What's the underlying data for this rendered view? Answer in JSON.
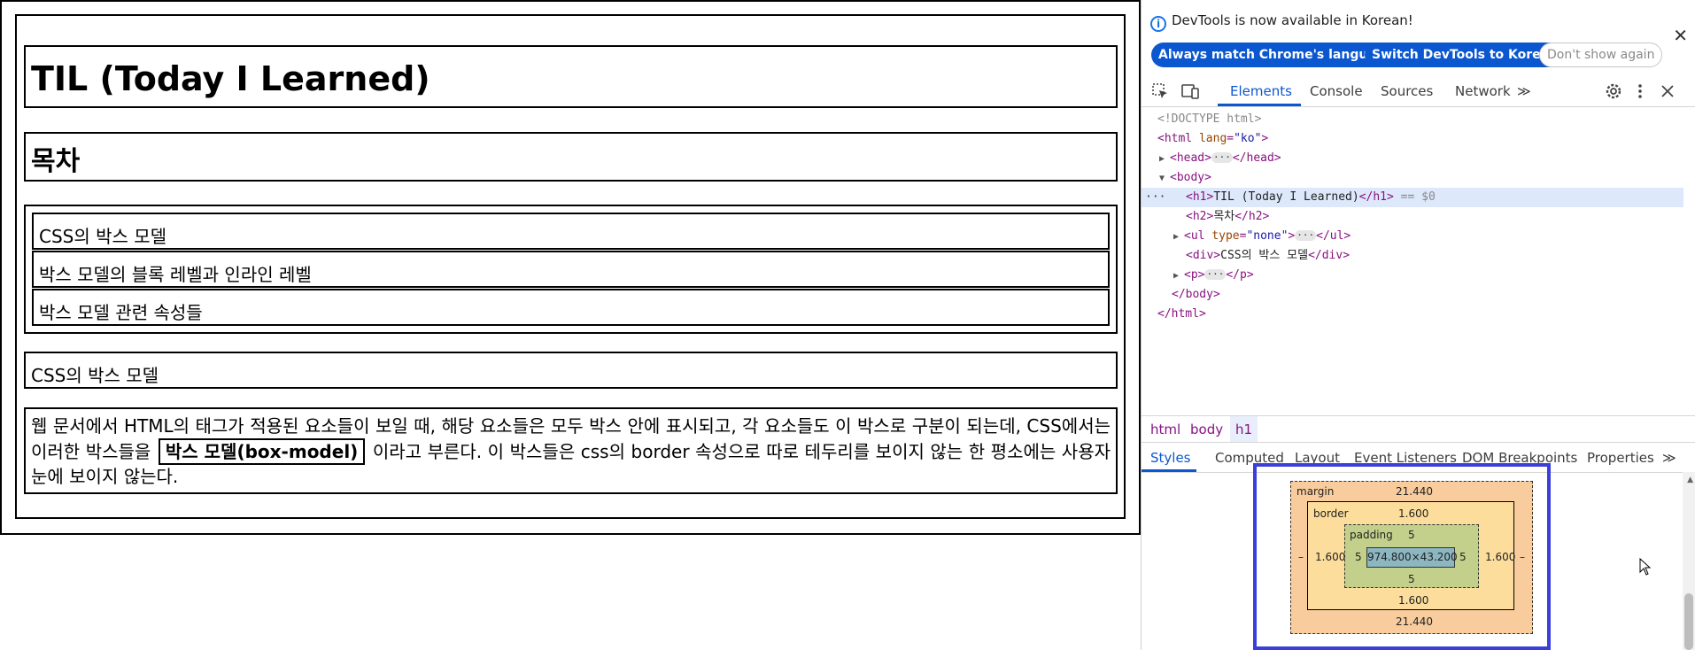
{
  "page": {
    "title": "TIL (Today I Learned)",
    "toc_heading": "목차",
    "toc_items": [
      "CSS의 박스 모델",
      "박스 모델의 블록 레벨과 인라인 레벨",
      "박스 모델 관련 속성들"
    ],
    "section_div": "CSS의 박스 모델",
    "paragraph": {
      "before": "웹 문서에서 HTML의 태그가 적용된 요소들이 보일 때, 해당 요소들은 모두 박스 안에 표시되고, 각 요소들도 이 박스로 구분이 되는데, CSS에서는 이러한 박스들을",
      "bold": "박스 모델(box-model)",
      "after": "이라고 부른다. 이 박스들은 css의 border 속성으로 따로 테두리를 보이지 않는 한 평소에는 사용자 눈에 보이지 않는다."
    }
  },
  "devtools": {
    "notice": "DevTools is now available in Korean!",
    "buttons": {
      "match": "Always match Chrome's language",
      "switch": "Switch DevTools to Korean",
      "dismiss": "Don't show again"
    },
    "tabs": [
      "Elements",
      "Console",
      "Sources",
      "Network"
    ],
    "more_tabs": "≫",
    "dom": {
      "doctype": "<!DOCTYPE html>",
      "html_open": "<html",
      "lang_attr": "lang",
      "lang_val": "\"ko\"",
      "head": "<head>",
      "head_close": "</head>",
      "body_open": "<body>",
      "h1_text": "TIL (Today I Learned)",
      "h1_selected": "== $0",
      "h2_text": "목차",
      "ul_attr": "type",
      "ul_val": "\"none\"",
      "div_text": "CSS의 박스 모델",
      "body_close": "</body>",
      "html_close": "</html>",
      "ellipsis": "···",
      "row_marker": "···"
    },
    "breadcrumbs": [
      "html",
      "body",
      "h1"
    ],
    "subtabs": [
      "Styles",
      "Computed",
      "Layout",
      "Event Listeners",
      "DOM Breakpoints",
      "Properties"
    ],
    "box_model": {
      "margin_label": "margin",
      "margin_top": "21.440",
      "margin_bottom": "21.440",
      "margin_left": "–",
      "margin_right": "–",
      "border_label": "border",
      "border_top": "1.600",
      "border_bottom": "1.600",
      "border_left": "1.600",
      "border_right": "1.600",
      "padding_label": "padding",
      "padding_top": "5",
      "padding_bottom": "5",
      "padding_left": "5",
      "padding_right": "5",
      "content": "974.800×43.200"
    }
  }
}
